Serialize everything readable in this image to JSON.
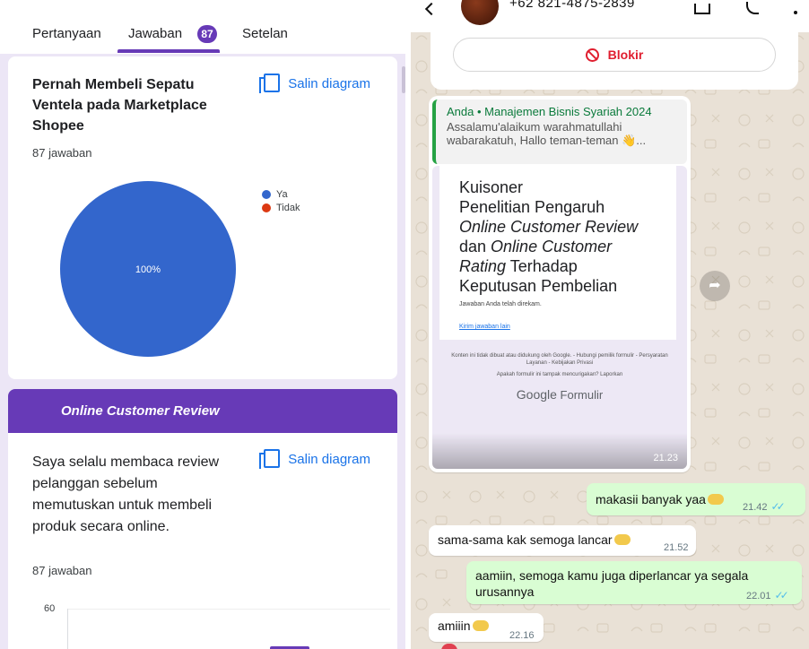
{
  "forms": {
    "tabs": [
      {
        "label": "Pertanyaan"
      },
      {
        "label": "Jawaban",
        "badge": "87"
      },
      {
        "label": "Setelan"
      }
    ],
    "accent": "#673ab7",
    "copy_label": "Salin diagram",
    "card1": {
      "title": "Pernah Membeli Sepatu Ventela pada Marketplace Shopee",
      "responses": "87 jawaban",
      "slice_label": "100%"
    },
    "section": {
      "title": "Online Customer Review"
    },
    "card2": {
      "title": "Saya selalu membaca review pelanggan sebelum memutuskan untuk membeli produk secara online.",
      "responses": "87 jawaban",
      "axis_max": "60"
    }
  },
  "chart_data": {
    "type": "pie",
    "categories": [
      "Ya",
      "Tidak"
    ],
    "values": [
      100,
      0
    ],
    "colors": [
      "#3366cc",
      "#dc3912"
    ],
    "legend": "right"
  },
  "whatsapp": {
    "header": {
      "phone": "+62 821-4875-2839"
    },
    "block_label": "Blokir",
    "forwarded": {
      "reply_sender": "Anda • Manajemen Bisnis Syariah 2024",
      "reply_text": "Assalamu'alaikum warahmatullahi wabarakatuh, Hallo teman-teman 👋...",
      "form_title_line1": "Kuisoner",
      "form_title_line2": "Penelitian Pengaruh",
      "form_title_line3_italic": "Online Customer Review",
      "form_title_line4_pre": "dan ",
      "form_title_line4_italic": "Online Customer",
      "form_title_line5_italic": "Rating",
      "form_title_line5_post": " Terhadap",
      "form_title_line6": "Keputusan Pembelian",
      "recorded": "Jawaban Anda telah direkam.",
      "link": "Kirim jawaban lain",
      "footer": "Konten ini tidak dibuat atau didukung oleh Google. - Hubungi pemilik formulir - Persyaratan Layanan - Kebijakan Privasi",
      "footer2": "Apakah formulir ini tampak mencurigakan? Laporkan",
      "brand_google": "Google",
      "brand_formulir": " Formulir",
      "time": "21.23"
    },
    "messages": [
      {
        "text": "makasii banyak yaa",
        "time": "21.42",
        "dir": "out"
      },
      {
        "text": "sama-sama kak semoga lancar",
        "time": "21.52",
        "dir": "in"
      },
      {
        "text": "aamiin, semoga kamu juga diperlancar ya segala urusannya",
        "time": "22.01",
        "dir": "out"
      },
      {
        "text": "amiiin",
        "time": "22.16",
        "dir": "in"
      }
    ],
    "read_color": "#53bdeb",
    "outgoing_color": "#d9fdd3"
  }
}
